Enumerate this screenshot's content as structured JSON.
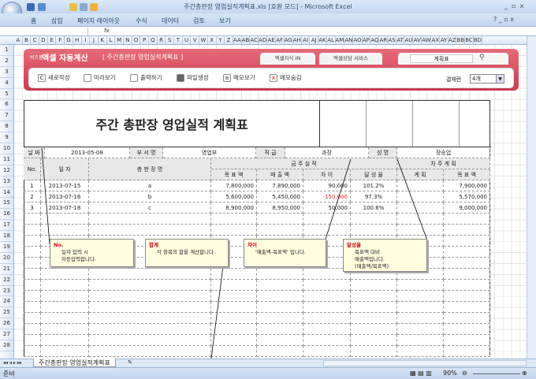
{
  "window": {
    "title": "주간총판장 영업실적계획표.xls  [호환 모드] - Microsoft Excel"
  },
  "ribbon": {
    "tabs": [
      "홈",
      "삽입",
      "페이지 레이아웃",
      "수식",
      "데이터",
      "검토",
      "보기"
    ]
  },
  "formula_bar": {
    "fx": "fx"
  },
  "columns": [
    "A",
    "B",
    "C",
    "D",
    "E",
    "F",
    "G",
    "H",
    "I",
    "J",
    "K",
    "L",
    "M",
    "N",
    "O",
    "P",
    "Q",
    "R",
    "S",
    "T",
    "U",
    "V",
    "W",
    "X",
    "Y",
    "Z",
    "AA",
    "AB",
    "AC",
    "AD",
    "AE",
    "AF",
    "AG",
    "AH",
    "AI",
    "AJ",
    "AK",
    "AL",
    "AM",
    "AN",
    "AO",
    "AP",
    "AQ",
    "AR",
    "AS",
    "AT",
    "AU",
    "AV",
    "AW",
    "AX",
    "AY",
    "AZ",
    "BB",
    "BC",
    "BD"
  ],
  "rows": [
    "1",
    "2",
    "3",
    "4",
    "5",
    "6",
    "7",
    "8",
    "9",
    "10",
    "11",
    "12",
    "13",
    "14",
    "15",
    "16",
    "17",
    "18",
    "19",
    "20",
    "21",
    "22",
    "23",
    "24",
    "25",
    "26",
    "27",
    "28"
  ],
  "banner": {
    "brand_small": "비즈폼",
    "brand": "엑셀 자동계산",
    "doc": "[ 주간총판장 영업실적계획표 ]",
    "tabs": [
      "엑셀지식 IN",
      "엑셀상담 서비스"
    ],
    "search_value": "계획표",
    "buttons": [
      "새로작성",
      "미리보기",
      "출력하기",
      "파일생성",
      "메모보기",
      "메모숨김"
    ],
    "approval_label": "결재란",
    "approval_value": "4개"
  },
  "form": {
    "title": "주간 총판장 영업실적 계획표",
    "info": {
      "date_label": "날 짜",
      "date": "2013-05-08",
      "dept_label": "부 서 명",
      "dept": "영업부",
      "rank_label": "직 급",
      "rank": "과장",
      "name_label": "성 명",
      "name": "장승업"
    },
    "headers": {
      "no": "No.",
      "date": "일    자",
      "store": "총   판   장   명",
      "this_week": "금   주   실   적",
      "next_week": "차   주   계   획",
      "target": "목 표 액",
      "sales": "매 출 액",
      "diff": "차   이",
      "rate": "달 성 율",
      "plan": "계   획",
      "next_target": "목 표 액"
    },
    "rows": [
      {
        "no": "1",
        "date": "2013-07-15",
        "store": "a",
        "target": "7,800,000",
        "sales": "7,890,000",
        "diff": "90,000",
        "rate": "101.2%",
        "plan": "",
        "next_target": "7,900,000"
      },
      {
        "no": "2",
        "date": "2013-07-16",
        "store": "b",
        "target": "5,600,000",
        "sales": "5,450,000",
        "diff": "-150,000",
        "rate": "97.3%",
        "plan": "",
        "next_target": "5,570,000"
      },
      {
        "no": "3",
        "date": "2013-07-18",
        "store": "c",
        "target": "8,900,000",
        "sales": "8,950,000",
        "diff": "50,000",
        "rate": "100.6%",
        "plan": "",
        "next_target": "9,000,000"
      }
    ],
    "notes": [
      {
        "title": "No.",
        "lines": [
          "일자 입력 시",
          "자동입력합니다."
        ]
      },
      {
        "title": "합계",
        "lines": [
          "각 항목의 합을 계산합니다."
        ]
      },
      {
        "title": "차이",
        "lines": [
          "'매출액-목표액' 입니다."
        ]
      },
      {
        "title": "달성율",
        "lines": [
          "목표액 대비",
          "매출액입니다.",
          "(매출액/목표액)"
        ]
      }
    ]
  },
  "sheet_tab": "주간총판장 영업실적계획표",
  "status": {
    "ready": "준비",
    "zoom": "90%"
  },
  "colors": {
    "banner": "#d8495c",
    "negative": "#e02020"
  }
}
